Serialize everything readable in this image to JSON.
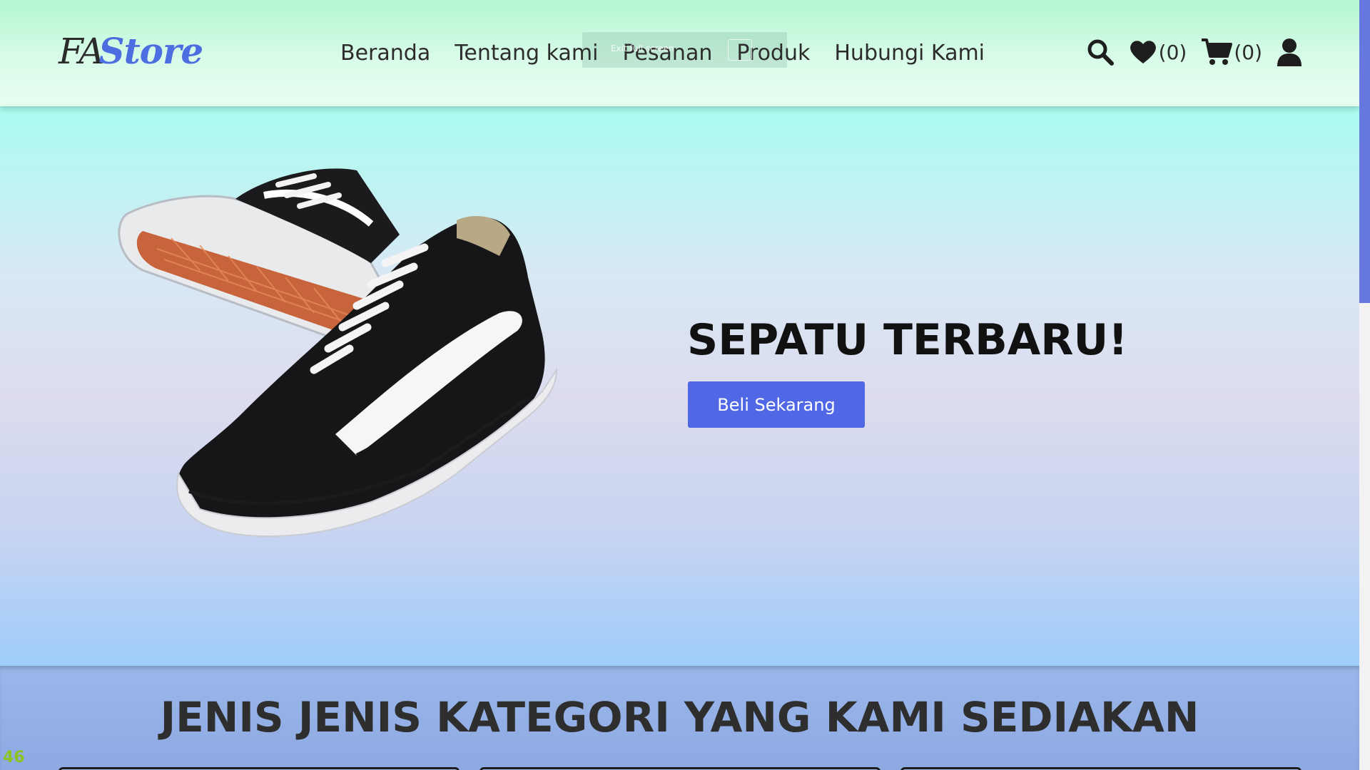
{
  "brand": {
    "part1": "FA",
    "part2": "Store"
  },
  "nav": {
    "items": [
      "Beranda",
      "Tentang kami",
      "Pesanan",
      "Produk",
      "Hubungi Kami"
    ],
    "overlay_text": "Exit full screen"
  },
  "header_icons": {
    "search": "search-icon",
    "wishlist": "heart-icon",
    "wishlist_count": "(0)",
    "cart": "cart-icon",
    "cart_count": "(0)",
    "account": "user-icon"
  },
  "hero": {
    "title": "SEPATU TERBARU!",
    "button_label": "Beli Sekarang"
  },
  "categories": {
    "title": "JENIS JENIS KATEGORI YANG KAMI SEDIAKAN"
  },
  "overlay": {
    "fps": "46"
  },
  "colors": {
    "accent": "#5068e6",
    "logo_blue": "#4c6ee0",
    "fps_green": "#8cc21f"
  }
}
